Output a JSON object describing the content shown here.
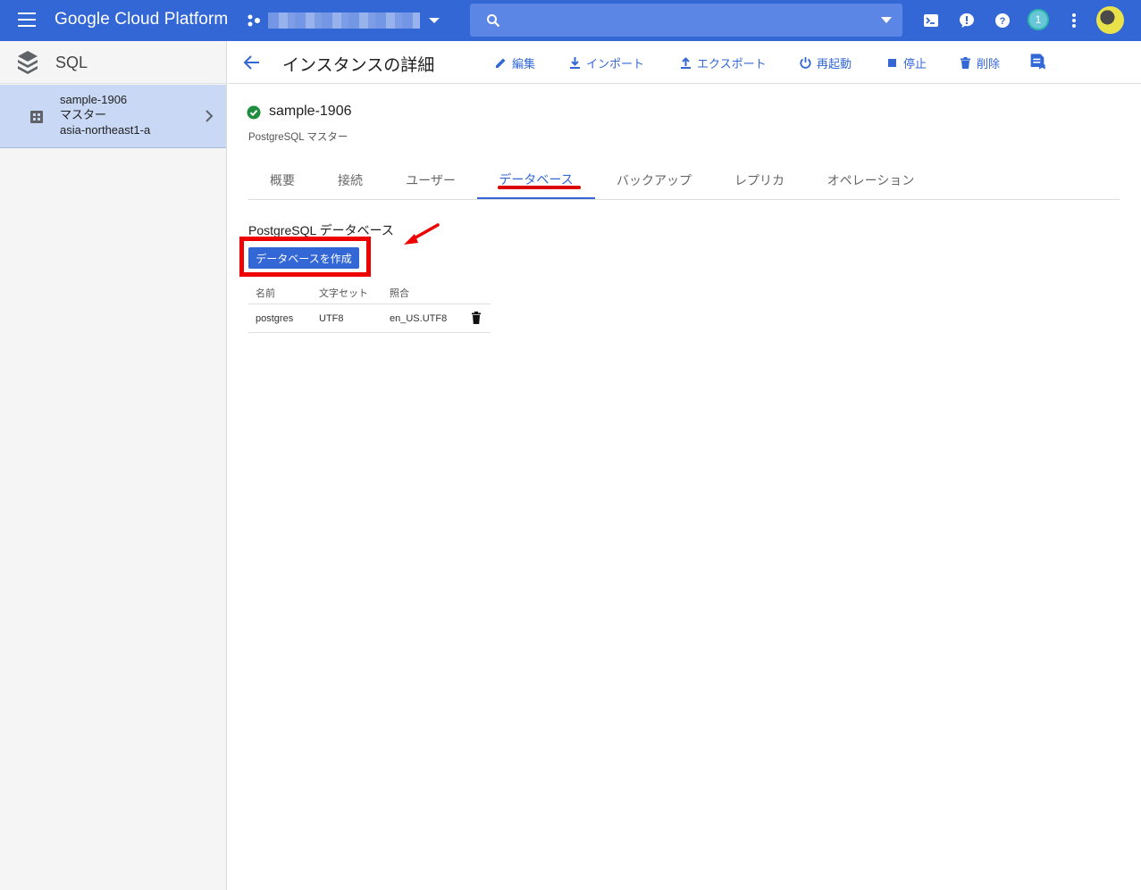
{
  "topbar": {
    "brand": "Google Cloud Platform",
    "notification_count": "1"
  },
  "product": {
    "title": "SQL"
  },
  "instance_list": [
    {
      "name": "sample-1906",
      "role": "マスター",
      "zone": "asia-northeast1-a"
    }
  ],
  "header": {
    "title": "インスタンスの詳細",
    "actions": {
      "edit": "編集",
      "import": "インポート",
      "export": "エクスポート",
      "restart": "再起動",
      "stop": "停止",
      "delete": "削除"
    }
  },
  "instance": {
    "name": "sample-1906",
    "subtitle": "PostgreSQL マスター",
    "status_color": "#1e8e3e"
  },
  "tabs": [
    {
      "label": "概要"
    },
    {
      "label": "接続"
    },
    {
      "label": "ユーザー"
    },
    {
      "label": "データベース",
      "active": true
    },
    {
      "label": "バックアップ"
    },
    {
      "label": "レプリカ"
    },
    {
      "label": "オペレーション"
    }
  ],
  "databases": {
    "section_title": "PostgreSQL データベース",
    "create_button": "データベースを作成",
    "columns": [
      "名前",
      "文字セット",
      "照合"
    ],
    "rows": [
      {
        "name": "postgres",
        "charset": "UTF8",
        "collation": "en_US.UTF8"
      }
    ]
  },
  "colors": {
    "accent": "#3367d6",
    "annotation_red": "#e00000"
  }
}
